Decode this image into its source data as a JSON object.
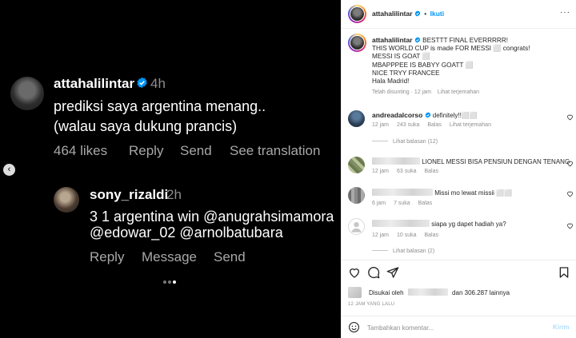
{
  "media": {
    "comment1": {
      "username": "attahalilintar",
      "time": "4h",
      "lines": [
        "prediksi saya argentina menang..",
        "(walau saya dukung prancis)"
      ],
      "actions": [
        "464 likes",
        "Reply",
        "Send",
        "See translation"
      ]
    },
    "comment2": {
      "username": "sony_rizaldi",
      "time": "2h",
      "lines": [
        "3 1 argentina win @anugrahsimamora",
        "@edowar_02  @arnolbatubara"
      ],
      "actions": [
        "Reply",
        "Message",
        "Send"
      ]
    },
    "nav_icon": "chevron-left-icon"
  },
  "header": {
    "username": "attahalilintar",
    "dot": "•",
    "follow": "Ikuti",
    "more_icon": "more-icon",
    "more": "···"
  },
  "caption": {
    "username": "attahalilintar",
    "first": "BESTTT FINAL EVERRRRR!",
    "lines": [
      "THIS WORLD CUP is made FOR MESSI ⬜ congrats!",
      "MESSI IS GOAT ⬜",
      "MBAPPPEE IS BABYY GOATT ⬜",
      "NICE TRYY FRANCEE",
      "Hala Madrid!"
    ],
    "edited": "Telah disunting · 12 jam",
    "see_translation": "Lihat terjemahan"
  },
  "comments": [
    {
      "username": "andreadalcorso",
      "text": "definitely!!⬜⬜",
      "meta": [
        "12 jam",
        "243 suka",
        "Balas",
        "Lihat terjemahan"
      ],
      "replies": "Lihat balasan (12)"
    },
    {
      "text": "LIONEL MESSI BISA PENSIUN DENGAN TENANG",
      "meta": [
        "12 jam",
        "63 suka",
        "Balas"
      ]
    },
    {
      "text": "Missi mo lewat missii ⬜⬜",
      "meta": [
        "6 jam",
        "7 suka",
        "Balas"
      ]
    },
    {
      "text": "siapa yg dapet hadiah ya?",
      "meta": [
        "12 jam",
        "10 suka",
        "Balas"
      ],
      "replies": "Lihat balasan (2)"
    }
  ],
  "likes": {
    "prefix": "Disukai oleh",
    "suffix": "dan 306.287 lainnya"
  },
  "post_time": "12 JAM YANG LALU",
  "composer": {
    "placeholder": "Tambahkan komentar...",
    "post": "Kirim"
  },
  "colors": {
    "link_blue": "#0095f6",
    "verified_blue": "#0095f6",
    "post_button_disabled": "#b2dffc"
  }
}
